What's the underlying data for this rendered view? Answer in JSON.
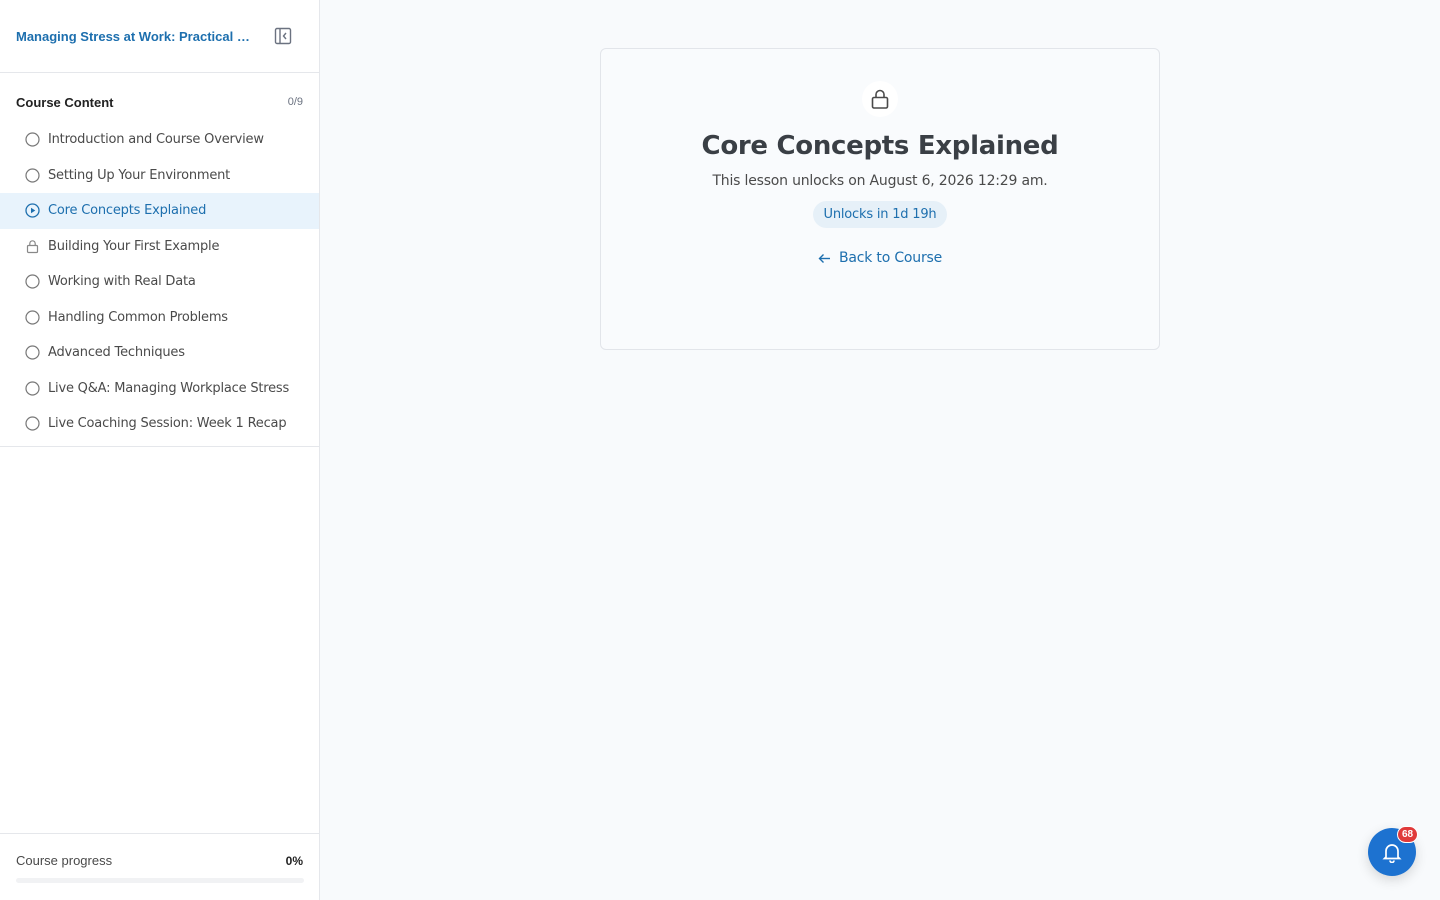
{
  "sidebar": {
    "course_title": "Managing Stress at Work: Practical Techniques",
    "content_title": "Course Content",
    "content_count": "0/9",
    "lessons": [
      {
        "label": "Introduction and Course Overview",
        "state": "not-started",
        "icon": "circle-icon"
      },
      {
        "label": "Setting Up Your Environment",
        "state": "not-started",
        "icon": "circle-icon"
      },
      {
        "label": "Core Concepts Explained",
        "state": "current",
        "icon": "play-circle-icon"
      },
      {
        "label": "Building Your First Example",
        "state": "locked",
        "icon": "lock-icon"
      },
      {
        "label": "Working with Real Data",
        "state": "not-started",
        "icon": "circle-icon"
      },
      {
        "label": "Handling Common Problems",
        "state": "not-started",
        "icon": "circle-icon"
      },
      {
        "label": "Advanced Techniques",
        "state": "not-started",
        "icon": "circle-icon"
      },
      {
        "label": "Live Q&A: Managing Workplace Stress",
        "state": "not-started",
        "icon": "circle-icon"
      },
      {
        "label": "Live Coaching Session: Week 1 Recap",
        "state": "not-started",
        "icon": "circle-icon"
      }
    ],
    "progress_label": "Course progress",
    "progress_value": "0%",
    "progress_fraction": 0
  },
  "main": {
    "lock_icon": "lock-icon",
    "title": "Core Concepts Explained",
    "unlock_text": "This lesson unlocks on August 6, 2026 12:29 am.",
    "countdown": "Unlocks in 1d 19h",
    "back_label": "Back to Course"
  },
  "notifications": {
    "icon": "bell-icon",
    "count": "68"
  },
  "colors": {
    "accent": "#1d6fae",
    "active_bg": "#e8f3fc",
    "notif_button": "#1d72d0",
    "notif_badge": "#e03a3a"
  }
}
